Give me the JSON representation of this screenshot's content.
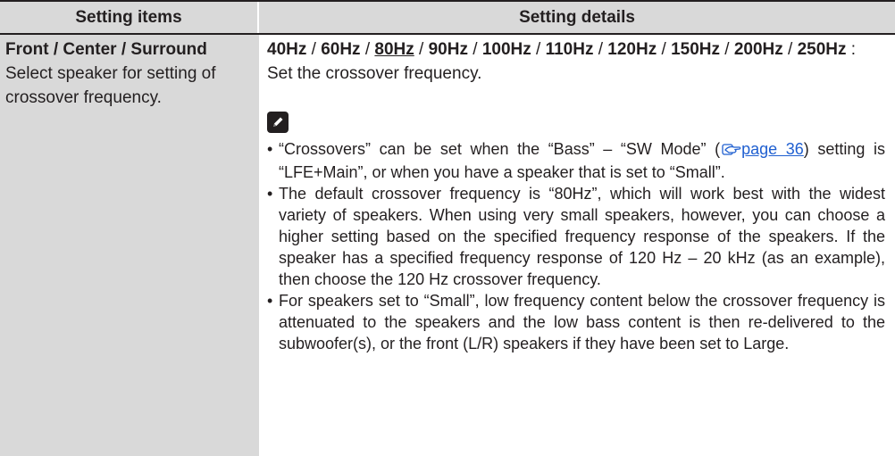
{
  "header": {
    "left": "Setting items",
    "right": "Setting details"
  },
  "item": {
    "title": "Front / Center / Surround",
    "description": "Select speaker for setting of crossover frequency."
  },
  "frequencies": {
    "options": [
      "40Hz",
      "60Hz",
      "80Hz",
      "90Hz",
      "100Hz",
      "110Hz",
      "120Hz",
      "150Hz",
      "200Hz",
      "250Hz"
    ],
    "default": "80Hz",
    "separator": " / ",
    "suffix": " : Set the crossover frequency."
  },
  "notes": {
    "icon": "pencil-icon",
    "note1_before": "“Crossovers” can be set when the “Bass” – “SW Mode” (",
    "note1_link": "page 36",
    "note1_after": ") setting is “LFE+Main”, or when you have a speaker that is set to “Small”.",
    "note2": "The default crossover frequency is “80Hz”, which will work best with the widest variety of speakers. When using very small speakers, however, you can choose a higher setting based on the specified frequency response of the speakers. If the speaker has a specified frequency response of 120 Hz – 20 kHz (as an example), then choose the 120 Hz crossover frequency.",
    "note3": "For speakers set to “Small”, low frequency content below the crossover frequency is attenuated to the speakers and the low bass content is then re-delivered to the subwoofer(s), or the front (L/R) speakers if they have been set to Large."
  },
  "colors": {
    "header_bg": "#d9d9d9",
    "left_col_bg": "#d9d9d9",
    "text": "#231f20",
    "link": "#1f5fd0"
  }
}
